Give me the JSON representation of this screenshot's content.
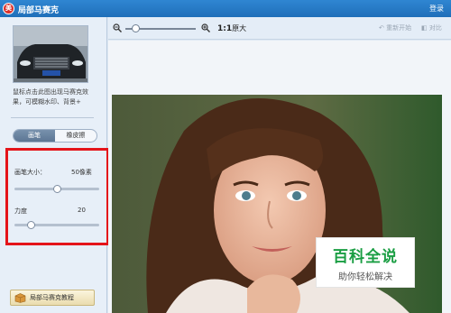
{
  "app": {
    "logo_glyph": "美",
    "title": "局部马赛克",
    "login": "登录"
  },
  "left": {
    "hint": "鼠标点击此图出现马赛克效果，可模糊水印、背景+",
    "tools": [
      {
        "label": "画笔",
        "active": true
      },
      {
        "label": "橡皮擦",
        "active": false
      }
    ],
    "brush_size": {
      "label": "画笔大小：",
      "value": "50像素",
      "level": 0.5
    },
    "strength": {
      "label": "力度",
      "value": "20",
      "level": 0.2
    },
    "tutorial_label": "局部马赛克教程"
  },
  "toolbar": {
    "zoom_level": 0.15,
    "ratio": "1:1",
    "ratio_suffix": "原大",
    "restart": "重新开始",
    "compare": "对比"
  },
  "watermark": {
    "title": "百科全说",
    "subtitle": "助你轻松解决"
  },
  "colors": {
    "titlebar": "#1f6fb9",
    "highlight": "#e4141a",
    "brand_green": "#1a9e43"
  }
}
